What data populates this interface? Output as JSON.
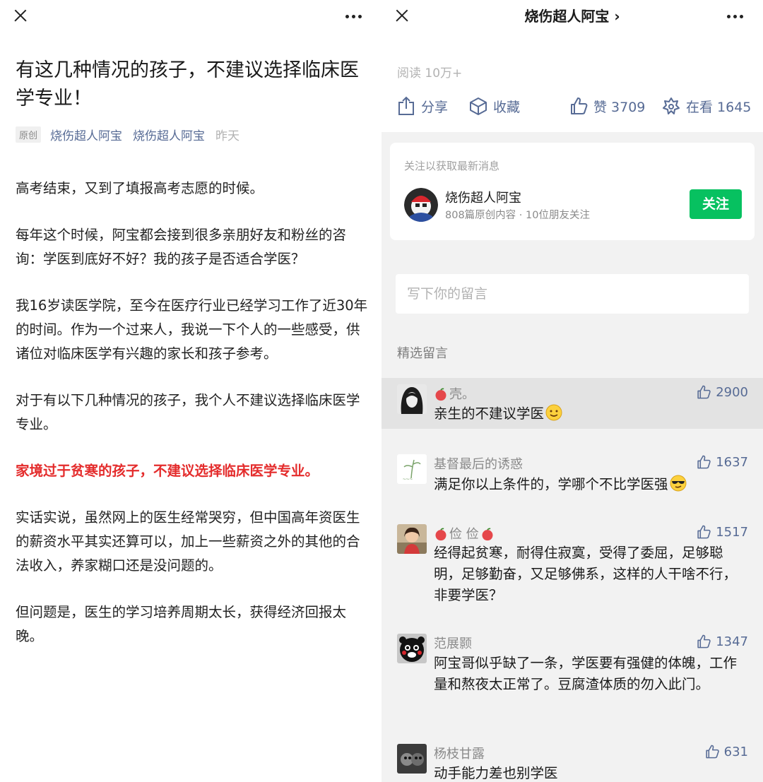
{
  "left": {
    "title": "有这几种情况的孩子，不建议选择临床医学专业！",
    "meta": {
      "tag": "原创",
      "author": "烧伤超人阿宝",
      "account": "烧伤超人阿宝",
      "date": "昨天"
    },
    "paragraphs": [
      "高考结束，又到了填报高考志愿的时候。",
      "每年这个时候，阿宝都会接到很多亲朋好友和粉丝的咨询：学医到底好不好？我的孩子是否适合学医？",
      "我16岁读医学院，至今在医疗行业已经学习工作了近30年的时间。作为一个过来人，我说一下个人的一些感受，供诸位对临床医学有兴趣的家长和孩子参考。",
      "对于有以下几种情况的孩子，我个人不建议选择临床医学专业。",
      "家境过于贫寒的孩子，不建议选择临床医学专业。",
      "实话实说，虽然网上的医生经常哭穷，但中国高年资医生的薪资水平其实还算可以，加上一些薪资之外的其他的合法收入，养家糊口还是没问题的。",
      "但问题是，医生的学习培养周期太长，获得经济回报太晚。"
    ]
  },
  "right": {
    "header_title": "烧伤超人阿宝 ›",
    "read_count": "阅读 10万+",
    "actions": {
      "share": "分享",
      "favorite": "收藏",
      "like": "赞 3709",
      "watching": "在看 1645"
    },
    "follow_card": {
      "hint": "关注以获取最新消息",
      "name": "烧伤超人阿宝",
      "sub": "808篇原创内容 · 10位朋友关注",
      "button": "关注"
    },
    "comment_placeholder": "写下你的留言",
    "featured_label": "精选留言",
    "comments": [
      {
        "nick": "壳。",
        "likes": "2900",
        "text": "亲生的不建议学医"
      },
      {
        "nick": "基督最后的诱惑",
        "likes": "1637",
        "text": "满足你以上条件的，学哪个不比学医强"
      },
      {
        "nick": "俭 俭",
        "likes": "1517",
        "text": "经得起贫寒，耐得住寂寞，受得了委屈，足够聪明，足够勤奋，又足够佛系，这样的人干啥不行，非要学医？"
      },
      {
        "nick": "范展颢",
        "likes": "1347",
        "text": "阿宝哥似乎缺了一条，学医要有强健的体魄，工作量和熬夜太正常了。豆腐渣体质的勿入此门。"
      },
      {
        "nick": "杨枝甘露",
        "likes": "631",
        "text": "动手能力差也别学医"
      }
    ]
  }
}
